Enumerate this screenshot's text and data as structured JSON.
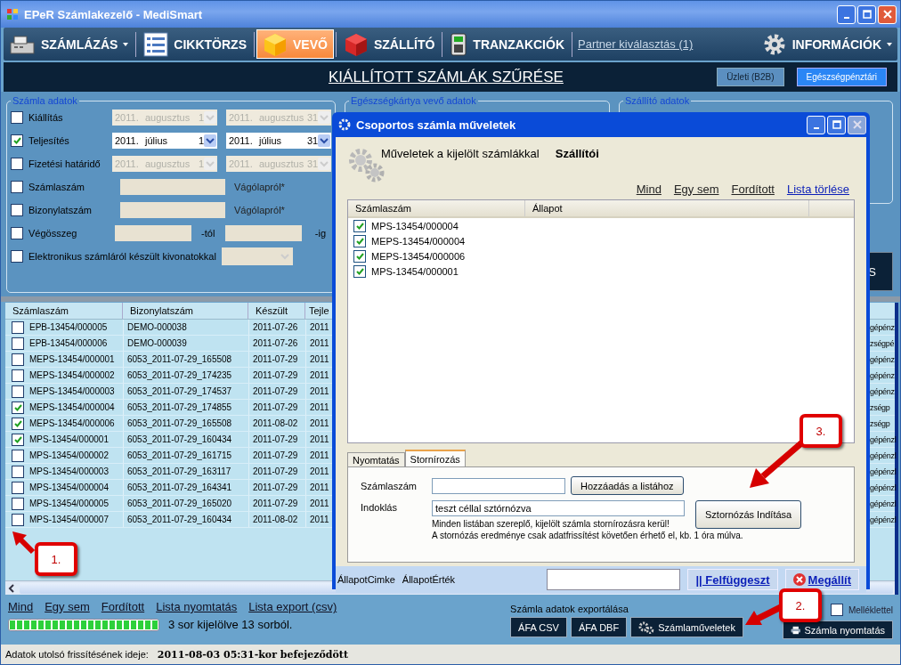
{
  "window": {
    "title": "EPeR Számlakezelő - MediSmart"
  },
  "toolbar": {
    "items": [
      {
        "label": "SZÁMLÁZÁS",
        "selected": false,
        "dropdown": true
      },
      {
        "label": "CIKKTÖRZS",
        "selected": false,
        "dropdown": false
      },
      {
        "label": "VEVŐ",
        "selected": true,
        "dropdown": false
      },
      {
        "label": "SZÁLLÍTÓ",
        "selected": false,
        "dropdown": false
      },
      {
        "label": "TRANZAKCIÓK",
        "selected": false,
        "dropdown": false
      }
    ],
    "partner_link": "Partner kiválasztás (1)",
    "info": {
      "label": "INFORMÁCIÓK",
      "dropdown": true
    }
  },
  "header": {
    "title": "KIÁLLÍTOTT SZÁMLÁK SZŰRÉSE",
    "modes": [
      {
        "label": "Üzleti (B2B)",
        "selected": false
      },
      {
        "label": "Egészségpénztári",
        "selected": true
      }
    ]
  },
  "filter": {
    "groups": [
      "Számla adatok",
      "Egészségkártya vevő adatok",
      "Szállító adatok"
    ],
    "rows": [
      {
        "kind": "daterange",
        "label": "Kiállítás",
        "checked": false,
        "from": {
          "year": "2011.",
          "month": "augusztus",
          "day": "1"
        },
        "to": {
          "year": "2011.",
          "month": "augusztus",
          "day": "31"
        }
      },
      {
        "kind": "daterange",
        "label": "Teljesítés",
        "checked": true,
        "from": {
          "year": "2011.",
          "month": "július",
          "day": "1"
        },
        "to": {
          "year": "2011.",
          "month": "július",
          "day": "31"
        }
      },
      {
        "kind": "daterange",
        "label": "Fizetési határidő",
        "checked": false,
        "from": {
          "year": "2011.",
          "month": "augusztus",
          "day": "1"
        },
        "to": {
          "year": "2011.",
          "month": "augusztus",
          "day": "31"
        }
      },
      {
        "kind": "text",
        "label": "Számlaszám",
        "checked": false,
        "hint": "Vágólapról*"
      },
      {
        "kind": "text",
        "label": "Bizonylatszám",
        "checked": false,
        "hint": "Vágólapról*"
      },
      {
        "kind": "range",
        "label": "Végösszeg",
        "checked": false,
        "from_suffix": "-tól",
        "to_suffix": "-ig"
      },
      {
        "kind": "select",
        "label": "Elektronikus számláról készült kivonatokkal",
        "checked": false
      }
    ],
    "search_button": "S"
  },
  "table": {
    "columns": [
      "Számlaszám",
      "Bizonylatszám",
      "Készült",
      "Tejle"
    ],
    "rows": [
      {
        "checked": false,
        "number": "EPB-13454/000005",
        "doc": "DEMO-000038",
        "made": "2011-07-26",
        "column_4": "2011",
        "column_last": "gépénz"
      },
      {
        "checked": false,
        "number": "EPB-13454/000006",
        "doc": "DEMO-000039",
        "made": "2011-07-26",
        "column_4": "2011",
        "column_last": "zségpé"
      },
      {
        "checked": false,
        "number": "MEPS-13454/000001",
        "doc": "6053_2011-07-29_165508",
        "made": "2011-07-29",
        "column_4": "2011",
        "column_last": "gépénz"
      },
      {
        "checked": false,
        "number": "MEPS-13454/000002",
        "doc": "6053_2011-07-29_174235",
        "made": "2011-07-29",
        "column_4": "2011",
        "column_last": "gépénz"
      },
      {
        "checked": false,
        "number": "MEPS-13454/000003",
        "doc": "6053_2011-07-29_174537",
        "made": "2011-07-29",
        "column_4": "2011",
        "column_last": "gépénz"
      },
      {
        "checked": true,
        "number": "MEPS-13454/000004",
        "doc": "6053_2011-07-29_174855",
        "made": "2011-07-29",
        "column_4": "2011",
        "column_last": "zségp"
      },
      {
        "checked": true,
        "number": "MEPS-13454/000006",
        "doc": "6053_2011-07-29_165508",
        "made": "2011-08-02",
        "column_4": "2011",
        "column_last": "zségp"
      },
      {
        "checked": true,
        "number": "MPS-13454/000001",
        "doc": "6053_2011-07-29_160434",
        "made": "2011-07-29",
        "column_4": "2011",
        "column_last": "gépénzl"
      },
      {
        "checked": false,
        "number": "MPS-13454/000002",
        "doc": "6053_2011-07-29_161715",
        "made": "2011-07-29",
        "column_4": "2011",
        "column_last": "gépénzl"
      },
      {
        "checked": false,
        "number": "MPS-13454/000003",
        "doc": "6053_2011-07-29_163117",
        "made": "2011-07-29",
        "column_4": "2011",
        "column_last": "gépénzl"
      },
      {
        "checked": false,
        "number": "MPS-13454/000004",
        "doc": "6053_2011-07-29_164341",
        "made": "2011-07-29",
        "column_4": "2011",
        "column_last": "gépénzl"
      },
      {
        "checked": false,
        "number": "MPS-13454/000005",
        "doc": "6053_2011-07-29_165020",
        "made": "2011-07-29",
        "column_4": "2011",
        "column_last": "gépénzl"
      },
      {
        "checked": false,
        "number": "MPS-13454/000007",
        "doc": "6053_2011-07-29_160434",
        "made": "2011-08-02",
        "column_4": "2011",
        "column_last": "gépénzl"
      }
    ]
  },
  "list_actions": [
    "Mind",
    "Egy sem",
    "Fordított",
    "Lista nyomtatás",
    "Lista export (csv)"
  ],
  "progress": {
    "level": 1,
    "text": "3 sor kijelölve 13 sorból."
  },
  "export": {
    "label": "Számla adatok exportálása",
    "buttons": [
      "ÁFA CSV",
      "ÁFA DBF"
    ],
    "operations_button": "Számlaműveletek",
    "attachment": {
      "label": "Melléklettel",
      "checked": false
    },
    "print_button": "Számla nyomtatás"
  },
  "status_bar": {
    "label": "Adatok utolsó frissítésének ideje:",
    "value": "2011-08-03 05:31-kor befejeződött"
  },
  "dialog": {
    "title": "Csoportos számla műveletek",
    "heading": "Műveletek a kijelölt számlákkal",
    "mode": "Szállítói",
    "links": [
      "Mind",
      "Egy sem",
      "Fordított"
    ],
    "clear_link": "Lista törlése",
    "list": {
      "columns": [
        "Számlaszám",
        "Állapot"
      ],
      "rows": [
        {
          "checked": true,
          "number": "MPS-13454/000004"
        },
        {
          "checked": true,
          "number": "MEPS-13454/000004"
        },
        {
          "checked": true,
          "number": "MEPS-13454/000006"
        },
        {
          "checked": true,
          "number": "MPS-13454/000001"
        }
      ]
    },
    "tabs": [
      {
        "label": "Nyomtatás",
        "selected": false
      },
      {
        "label": "Stornírozás",
        "selected": true
      }
    ],
    "storno": {
      "number_label": "Számlaszám",
      "add_button": "Hozzáadás a listához",
      "reason_label": "Indoklás",
      "reason_value": "teszt céllal sztórnózva",
      "notes": [
        "Minden listában szereplő, kijelölt számla stornírozásra kerül!",
        "A stornózás eredménye csak adatfrissítést követően érhető el, kb. 1 óra múlva."
      ],
      "start_button": "Sztornózás Indítása"
    },
    "status": {
      "label": "ÁllapotCimke",
      "value": "ÁllapotÉrték",
      "pause_button": "|| Felfüggeszt",
      "stop_button": "Megállít"
    }
  },
  "callouts": [
    "1.",
    "2.",
    "3."
  ]
}
